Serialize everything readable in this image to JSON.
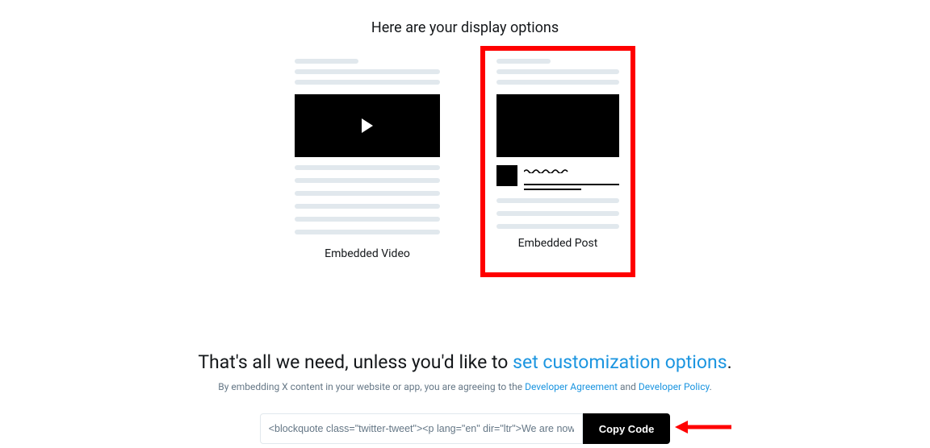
{
  "heading": "Here are your display options",
  "options": {
    "video_label": "Embedded Video",
    "post_label": "Embedded Post"
  },
  "footer": {
    "main_prefix": "That's all we need, unless you'd like to ",
    "main_link": "set customization options",
    "main_suffix": ".",
    "sub_prefix": "By embedding X content in your website or app, you are agreeing to the ",
    "agreement_link": "Developer Agreement",
    "sub_mid": " and ",
    "policy_link": "Developer Policy",
    "sub_suffix": "."
  },
  "code": {
    "value": "<blockquote class=\"twitter-tweet\"><p lang=\"en\" dir=\"ltr\">We are now on ",
    "button": "Copy Code"
  }
}
